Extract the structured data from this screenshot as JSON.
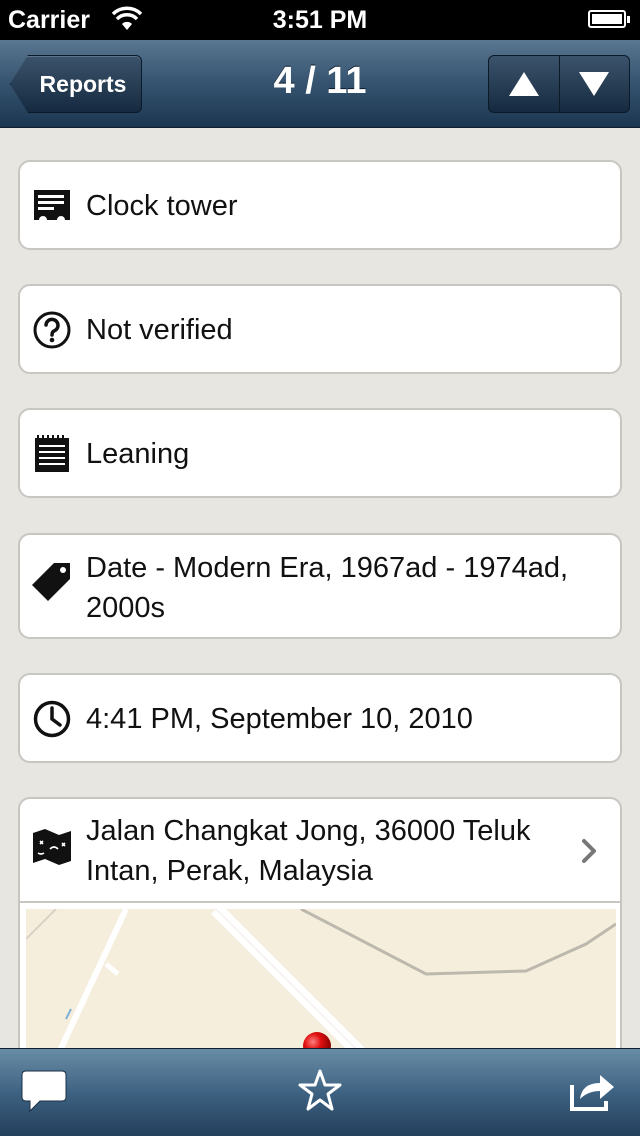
{
  "status_bar": {
    "carrier": "Carrier",
    "time": "3:51 PM"
  },
  "nav": {
    "back_label": "Reports",
    "title": "4 / 11"
  },
  "details": {
    "title": "Clock tower",
    "verification": "Not verified",
    "description": "Leaning",
    "category": "Date - Modern Era, 1967ad - 1974ad, 2000s",
    "datetime": "4:41 PM, September 10, 2010",
    "location": "Jalan Changkat Jong, 36000 Teluk Intan, Perak, Malaysia"
  },
  "colors": {
    "nav_dark": "#1c3651",
    "pin_red": "#e01010",
    "map_bg": "#f5eedc"
  }
}
